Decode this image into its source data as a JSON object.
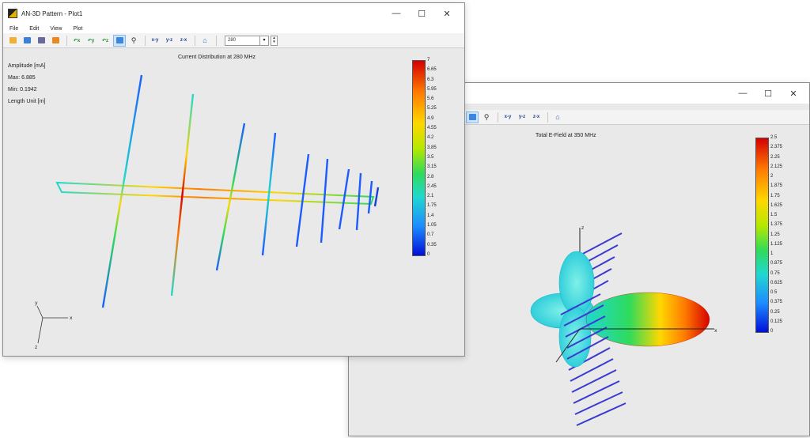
{
  "window1": {
    "title": "AN-3D Pattern - Plot1",
    "menu": [
      "File",
      "Edit",
      "View",
      "Plot"
    ],
    "toolbar": {
      "rotate_x": "↶x",
      "rotate_y": "↶y",
      "rotate_z": "↶z",
      "view_xy": "x-y",
      "view_yz": "y-z",
      "view_zx": "z-x",
      "frequency_value": "280"
    },
    "plot_title": "Current Distribution at 280 MHz",
    "info": {
      "amplitude": "Amplitude [mA]",
      "max": "Max: 6.885",
      "min": "Min: 0.1942",
      "length_unit": "Length Unit [m]"
    },
    "colorbar_ticks": [
      "7",
      "6.65",
      "6.3",
      "5.95",
      "5.6",
      "5.25",
      "4.9",
      "4.55",
      "4.2",
      "3.85",
      "3.5",
      "3.15",
      "2.8",
      "2.45",
      "2.1",
      "1.75",
      "1.4",
      "1.05",
      "0.7",
      "0.35",
      "0"
    ],
    "axes_labels": {
      "y": "y",
      "z": "z",
      "x": "x"
    }
  },
  "window2": {
    "title": "",
    "toolbar": {
      "view_xy": "x-y",
      "view_yz": "y-z",
      "view_zx": "z-x"
    },
    "plot_title": "Total E-Field at 350 MHz",
    "colorbar_ticks": [
      "2.5",
      "2.375",
      "2.25",
      "2.125",
      "2",
      "1.875",
      "1.75",
      "1.625",
      "1.5",
      "1.375",
      "1.25",
      "1.125",
      "1",
      "0.875",
      "0.75",
      "0.625",
      "0.5",
      "0.375",
      "0.25",
      "0.125",
      "0"
    ],
    "axes_labels": {
      "z": "z",
      "x": "x"
    }
  },
  "window_controls": {
    "minimize": "—",
    "maximize": "☐",
    "close": "✕"
  },
  "colors": {
    "red": "#d40000",
    "orange": "#ff7a00",
    "yellow": "#ffd700",
    "green": "#2edb5c",
    "cyan": "#20d8d0",
    "blue": "#1c5cff"
  }
}
